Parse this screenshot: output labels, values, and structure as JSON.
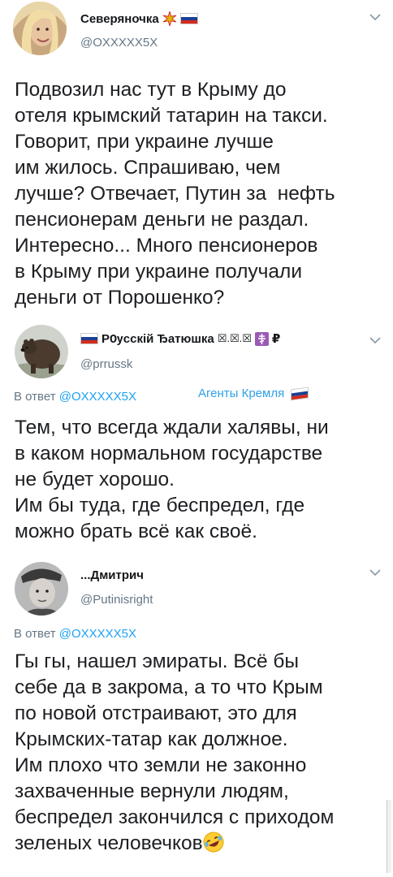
{
  "tweet1": {
    "author_name": "Северяночка",
    "author_handle": "@OXXXXX5X",
    "text": "Подвозил нас тут в Крыму до\nотеля крымский татарин на такси.\nГоворит, при украине лучше\nим жилось. Спрашиваю, чем\nлучше? Отвечает, Путин за  нефть\nпенсионерам деньги не раздал.\nИнтересно... Много пенсионеров\nв Крыму при украине получали\nденьги от Порошенко?"
  },
  "reply1": {
    "author_name": "РѸсскiй Ђатюшка",
    "author_suffix": "☒.☒.☒",
    "author_handle": "@prrussk",
    "reply_prefix": "В ответ",
    "reply_to": "@OXXXXX5X",
    "author_bio_tag": "Агенты Кремля",
    "text": "Тем, что всегда ждали халявы, ни\nв каком нормальном государстве\nне будет хорошо.\nИм бы туда, где беспредел, где\nможно брать всё как своё."
  },
  "reply2": {
    "author_name": "...Дмитрич",
    "author_handle": "@Putinisright",
    "reply_prefix": "В ответ",
    "reply_to": "@OXXXXX5X",
    "text": "Гы гы, нашел эмираты. Всё бы\nсебе да в закрома, а то что Крым\nпо новой отстраивают, это для\nКрымских-татар как должное.\nИм плохо что земли не законно\nзахваченные вернули людям,\nбеспредел закончился с приходом\nзеленых человечков"
  },
  "icons": {
    "chevron": "chevron-down-icon",
    "emoji": "rolling-on-floor-laughing-emoji",
    "flag": "russia-flag-icon",
    "sparkle": "sparkle-emoji",
    "cross": "orthodox-cross-emoji",
    "ruble": "ruble-sign"
  },
  "colors": {
    "text": "#1c1e21",
    "muted": "#657786",
    "link": "#1da1f2",
    "bio_tag": "#2ea0e6"
  }
}
